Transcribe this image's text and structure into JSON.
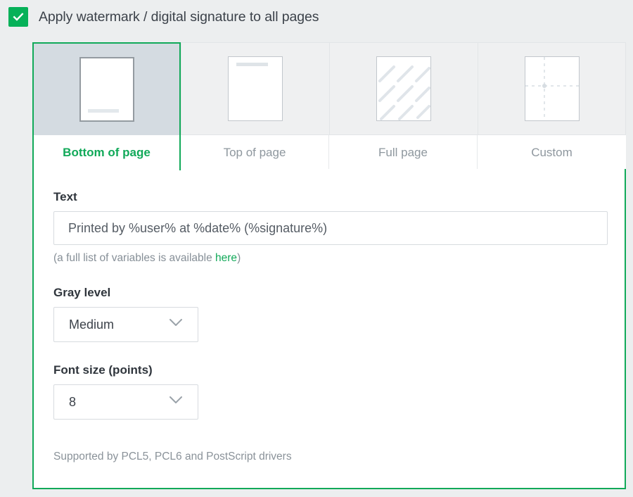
{
  "checkbox": {
    "checked": true,
    "label": "Apply watermark / digital signature to all pages",
    "accent_color": "#06b159",
    "icon": "check-icon"
  },
  "tabs": {
    "selected_index": 0,
    "items": [
      {
        "label": "Bottom of page",
        "thumbnail": "line-at-bottom",
        "selected": true
      },
      {
        "label": "Top of page",
        "thumbnail": "line-at-top",
        "selected": false
      },
      {
        "label": "Full page",
        "thumbnail": "diagonal-stripes",
        "selected": false
      },
      {
        "label": "Custom",
        "thumbnail": "dashed-crosshair",
        "selected": false
      }
    ]
  },
  "form": {
    "text": {
      "label": "Text",
      "value": "Printed by %user% at %date% (%signature%)",
      "placeholder": "Printed by %user% at %date% (%signature%)",
      "help_prefix": "(a full list of variables is available ",
      "help_link": "here",
      "help_suffix": ")"
    },
    "gray_level": {
      "label": "Gray level",
      "value": "Medium",
      "icon": "chevron-down-icon"
    },
    "font_size": {
      "label": "Font size (points)",
      "value": "8",
      "icon": "chevron-down-icon"
    },
    "footnote": "Supported by PCL5, PCL6 and PostScript drivers"
  },
  "colors": {
    "accent_green": "#11a959",
    "page_background": "#eceeef",
    "selected_thumb_background": "#d4dbe1",
    "thumb_background": "#eff0f1",
    "text_primary": "#3c424a",
    "text_muted": "#8e979e"
  }
}
